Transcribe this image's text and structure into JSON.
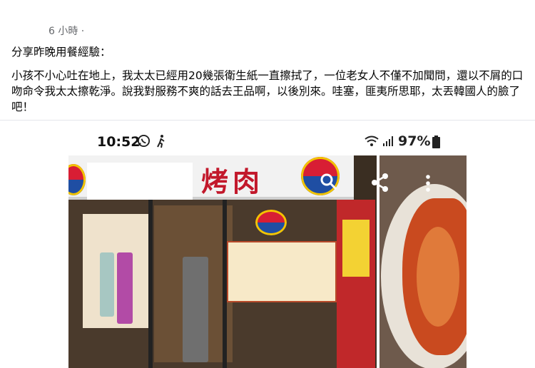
{
  "post": {
    "time_label": "6 小時 ·",
    "heading": "分享昨晚用餐經驗：",
    "body": "小孩不小心吐在地上，我太太已經用20幾張衛生紙一直擦拭了，一位老女人不僅不加聞問，還以不屑的口吻命令我太太擦乾淨。說我對服務不爽的話去王品啊，以後別來。哇塞，匪夷所思耶，太丟韓國人的臉了吧！"
  },
  "screenshot": {
    "status_bar": {
      "time": "10:52",
      "whatsapp_icon": "whatsapp-icon",
      "walk_icon": "walking-icon",
      "wifi_icon": "wifi-icon",
      "signal_icon": "signal-icon",
      "battery_percent": "97%",
      "battery_icon": "battery-icon"
    },
    "photo": {
      "sign_text": "烤肉",
      "search_icon": "search-icon",
      "share_icon": "share-icon",
      "more_icon": "more-vertical-icon"
    }
  },
  "colors": {
    "sign_red": "#c2182b",
    "taegeuk_red": "#d81e34",
    "taegeuk_blue": "#1f4ea3"
  }
}
